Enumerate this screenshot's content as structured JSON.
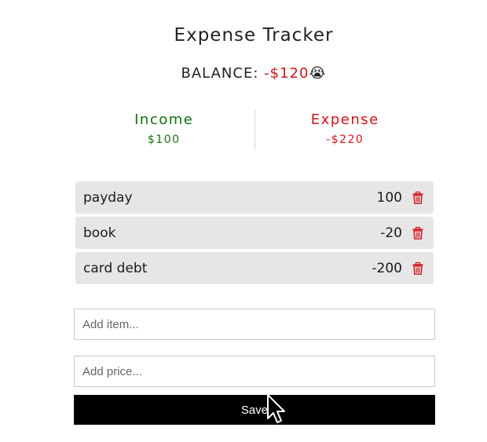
{
  "app": {
    "title": "Expense Tracker"
  },
  "balance": {
    "label": "BALANCE:",
    "amount": "-$120",
    "emoji": "😭"
  },
  "summary": {
    "income_label": "Income",
    "income_value": "$100",
    "expense_label": "Expense",
    "expense_value": "-$220"
  },
  "transactions": [
    {
      "name": "payday",
      "price": "100"
    },
    {
      "name": "book",
      "price": "-20"
    },
    {
      "name": "card debt",
      "price": "-200"
    }
  ],
  "form": {
    "item_placeholder": "Add item...",
    "price_placeholder": "Add price...",
    "save_label": "Save"
  },
  "colors": {
    "income": "#127012",
    "expense": "#d0141b",
    "row_background": "#e6e6e6",
    "button_background": "#000000"
  },
  "icons": {
    "delete": "trash-icon",
    "pointer": "mouse-cursor-icon"
  }
}
